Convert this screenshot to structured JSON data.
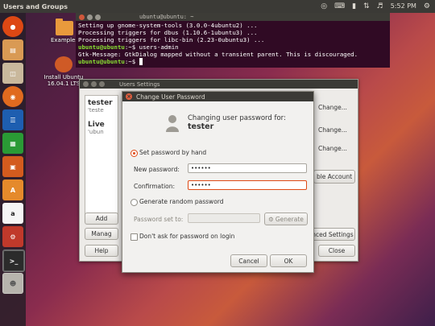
{
  "top_panel": {
    "title": "Users and Groups",
    "indicators": [
      "ubuntu-logo-icon",
      "keyboard-icon",
      "battery-icon",
      "network-icon",
      "volume-icon"
    ],
    "time": "5:52 PM"
  },
  "launcher": {
    "items": [
      "dash-icon",
      "files-icon",
      "file-cabinet-icon",
      "firefox-icon",
      "writer-icon",
      "calc-icon",
      "impress-icon",
      "software-center-icon",
      "amazon-icon",
      "settings-icon",
      "terminal-icon",
      "users-icon"
    ]
  },
  "desktop": {
    "icons": [
      {
        "label": "Examples"
      },
      {
        "label": "Install Ubuntu",
        "label2": "16.04.1 LTS"
      }
    ]
  },
  "terminal": {
    "title": "ubuntu@ubuntu: ~",
    "lines": [
      "Setting up gnome-system-tools (3.0.0-4ubuntu2) ...",
      "Processing triggers for dbus (1.10.6-1ubuntu3) ...",
      "Processing triggers for libc-bin (2.23-0ubuntu3) ..."
    ],
    "prompt": "ubuntu@ubuntu",
    "cmd_suffix": ":~$ users-admin",
    "gtk_message": "Gtk-Message: GtkDialog mapped without a transient parent. This is discouraged.",
    "prompt2_suffix": ":~$"
  },
  "users_settings": {
    "title": "Users Settings",
    "users": [
      {
        "name": "tester",
        "sub": "'teste"
      },
      {
        "name": "Live",
        "sub": "'ubun"
      }
    ],
    "change_labels": [
      "Change...",
      "Change...",
      "Change..."
    ],
    "enable_account_label": "ble Account",
    "add_label": "Add",
    "manage_label": "Manag",
    "advanced_settings_label": "nced Settings",
    "help_label": "Help",
    "close_label": "Close"
  },
  "change_password": {
    "title": "Change User Password",
    "header_line1": "Changing user password for:",
    "header_user": "tester",
    "set_by_hand_label": "Set password by hand",
    "new_password_label": "New password:",
    "new_password_value": "••••••",
    "confirmation_label": "Confirmation:",
    "confirmation_value": "••••••",
    "generate_random_label": "Generate random password",
    "password_set_to_label": "Password set to:",
    "password_set_to_value": "",
    "generate_button_label": "Generate",
    "dont_ask_label": "Don't ask for password on login",
    "cancel_label": "Cancel",
    "ok_label": "OK",
    "set_by_hand_selected": true
  }
}
